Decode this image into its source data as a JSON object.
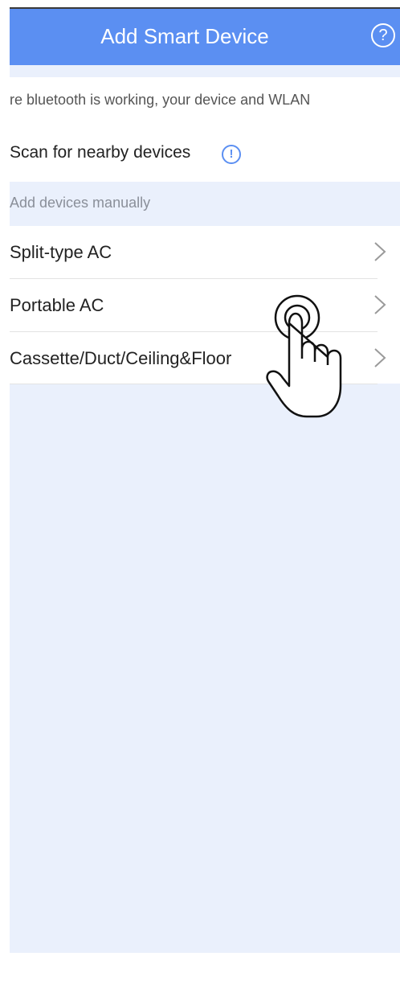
{
  "header": {
    "title": "Add Smart Device",
    "help_icon": "?"
  },
  "hint": {
    "text": "ure bluetooth is working, your device and WLAN"
  },
  "scan": {
    "label": "Scan for nearby devices",
    "info_icon": "!"
  },
  "manual_section": {
    "label": "Add devices manually"
  },
  "device_types": [
    {
      "label": "Split-type AC"
    },
    {
      "label": "Portable AC"
    },
    {
      "label": "Cassette/Duct/Ceiling&Floor"
    }
  ],
  "colors": {
    "header_bg": "#5b8ff2",
    "page_bg": "#eaf0fc",
    "accent": "#5b8ff2"
  }
}
